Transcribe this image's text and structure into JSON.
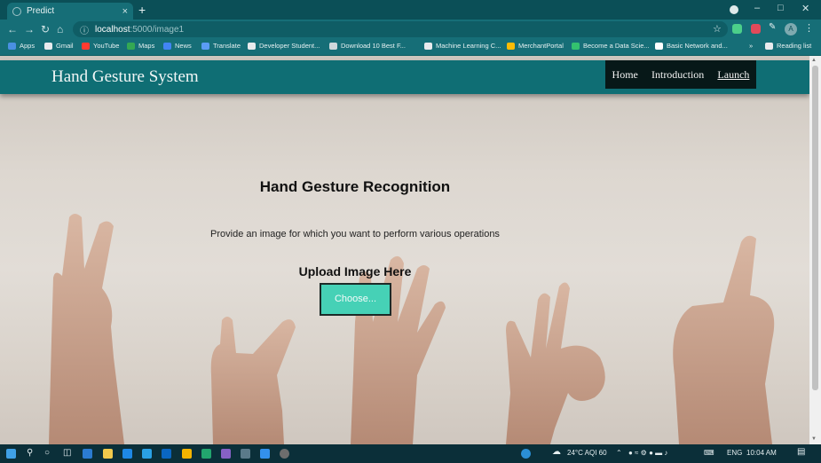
{
  "browser": {
    "tab_title": "Predict",
    "tab_close": "×",
    "new_tab": "+",
    "url_host": "localhost",
    "url_path": ":5000/image1",
    "bookmarks": [
      "Apps",
      "Gmail",
      "YouTube",
      "Maps",
      "News",
      "Translate",
      "Developer Student...",
      "Download 10 Best F...",
      "Machine Learning C...",
      "MerchantPortal",
      "Become a Data Scie...",
      "Basic Network and...",
      "»",
      "Reading list"
    ],
    "profile_initial": "A"
  },
  "navbar": {
    "brand": "Hand Gesture System",
    "links": [
      "Home",
      "Introduction",
      "Launch"
    ]
  },
  "main": {
    "title": "Hand Gesture Recognition",
    "description": "Provide an image for which you want to perform various operations",
    "upload_label": "Upload Image Here",
    "choose_button": "Choose..."
  },
  "taskbar": {
    "weather": "24°C AQI 60",
    "language": "ENG",
    "time": "10:04 AM"
  },
  "colors": {
    "brand_teal": "#0f6e74",
    "button": "#46d1b6",
    "nav_dark": "#071818"
  }
}
